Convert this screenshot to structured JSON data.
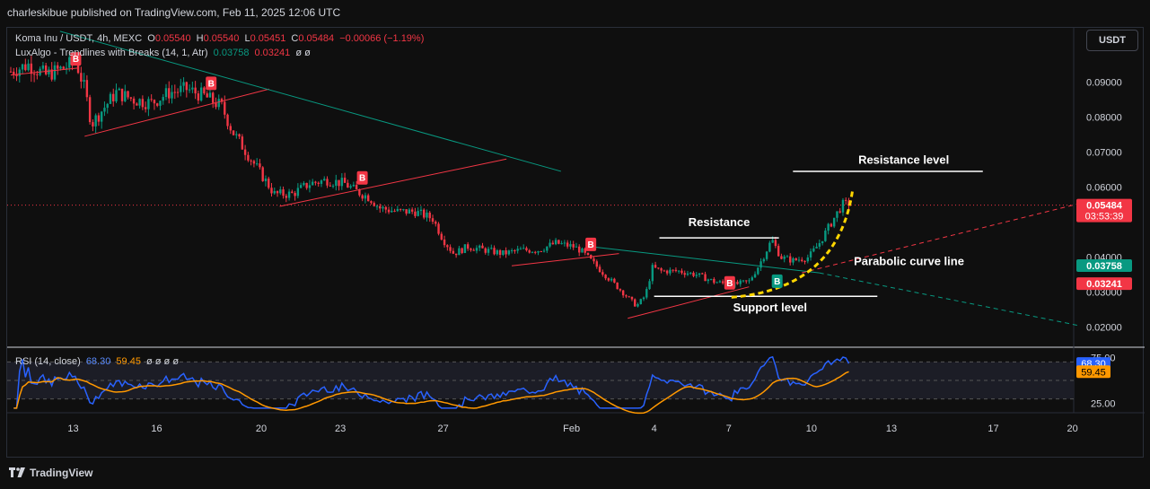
{
  "header": {
    "published": "charleskibue published on TradingView.com, Feb 11, 2025 12:06 UTC"
  },
  "legend": {
    "symbol": "Koma Inu / USDT, 4h, MEXC",
    "o_label": "O",
    "o_value": "0.05540",
    "h_label": "H",
    "h_value": "0.05540",
    "l_label": "L",
    "l_value": "0.05451",
    "c_label": "C",
    "c_value": "0.05484",
    "change": "−0.00066 (−1.19%)",
    "indicator": "LuxAlgo - Trendlines with Breaks (14, 1, Atr)",
    "ind_v1": "0.03758",
    "ind_v2": "0.03241",
    "ind_nulls": "ø ø",
    "rsi": "RSI (14, close)",
    "rsi_v1": "68.30",
    "rsi_v2": "59.45",
    "rsi_nulls": "ø ø ø ø"
  },
  "currency_button": "USDT",
  "branding": "TradingView",
  "colors": {
    "up": "#089981",
    "down": "#f23645",
    "rsi": "#2962ff",
    "rsi_ma": "#ff9800",
    "annotation_yellow": "#ffd600"
  },
  "chart_data": {
    "type": "candlestick",
    "symbol": "Koma Inu / USDT",
    "interval": "4h",
    "exchange": "MEXC",
    "x_tick_labels": [
      "13",
      "16",
      "20",
      "23",
      "27",
      "Feb",
      "4",
      "7",
      "10",
      "13",
      "17",
      "20"
    ],
    "y_ticks": [
      "0.09000",
      "0.08000",
      "0.07000",
      "0.06000",
      "0.04000",
      "0.03000",
      "0.02000"
    ],
    "ylim": [
      0.0145,
      0.1055
    ],
    "price_labels": [
      {
        "value": 0.05484,
        "text": "0.05484",
        "countdown": "03:53:39",
        "color": "#f23645"
      },
      {
        "value": 0.03758,
        "text": "0.03758",
        "color": "#089981"
      },
      {
        "value": 0.03241,
        "text": "0.03241",
        "color": "#f23645"
      }
    ],
    "ohlc_path": [
      [
        0,
        0.093
      ],
      [
        1,
        0.095
      ],
      [
        2,
        0.092
      ],
      [
        3,
        0.094
      ],
      [
        3.7,
        0.096
      ],
      [
        4.2,
        0.088
      ],
      [
        4.6,
        0.078
      ],
      [
        5.2,
        0.082
      ],
      [
        6,
        0.087
      ],
      [
        7,
        0.085
      ],
      [
        8,
        0.084
      ],
      [
        9,
        0.087
      ],
      [
        10,
        0.088
      ],
      [
        11,
        0.086
      ],
      [
        12,
        0.083
      ],
      [
        12.6,
        0.076
      ],
      [
        13.4,
        0.07
      ],
      [
        14.2,
        0.064
      ],
      [
        15,
        0.058
      ],
      [
        16,
        0.058
      ],
      [
        17,
        0.061
      ],
      [
        18,
        0.062
      ],
      [
        19,
        0.061
      ],
      [
        19.6,
        0.059
      ],
      [
        20.4,
        0.057
      ],
      [
        21,
        0.054
      ],
      [
        22,
        0.053
      ],
      [
        23,
        0.053
      ],
      [
        24,
        0.051
      ],
      [
        24.6,
        0.045
      ],
      [
        25.2,
        0.041
      ],
      [
        26,
        0.043
      ],
      [
        27,
        0.042
      ],
      [
        28,
        0.041
      ],
      [
        29,
        0.042
      ],
      [
        30,
        0.042
      ],
      [
        31,
        0.044
      ],
      [
        32,
        0.043
      ],
      [
        32.4,
        0.042
      ],
      [
        33.2,
        0.038
      ],
      [
        34,
        0.034
      ],
      [
        35,
        0.029
      ],
      [
        35.6,
        0.026
      ],
      [
        36.1,
        0.029
      ],
      [
        36.5,
        0.037
      ],
      [
        37,
        0.036
      ],
      [
        38,
        0.036
      ],
      [
        39,
        0.035
      ],
      [
        40,
        0.033
      ],
      [
        41,
        0.032
      ],
      [
        42,
        0.033
      ],
      [
        42.6,
        0.038
      ],
      [
        43.3,
        0.045
      ],
      [
        43.8,
        0.04
      ],
      [
        44.5,
        0.039
      ],
      [
        45.4,
        0.04
      ],
      [
        46,
        0.044
      ],
      [
        46.7,
        0.05
      ],
      [
        47.3,
        0.055
      ],
      [
        47.7,
        0.055
      ]
    ],
    "signals": [
      {
        "label": "B",
        "color": "#f23645",
        "x": 3.7,
        "price": 0.0965
      },
      {
        "label": "B",
        "color": "#f23645",
        "x": 11.4,
        "price": 0.0895
      },
      {
        "label": "B",
        "color": "#f23645",
        "x": 20,
        "price": 0.0625
      },
      {
        "label": "B",
        "color": "#f23645",
        "x": 33,
        "price": 0.0435
      },
      {
        "label": "B",
        "color": "#f23645",
        "x": 40.9,
        "price": 0.0325
      },
      {
        "label": "B",
        "color": "#089981",
        "x": 43.6,
        "price": 0.033
      }
    ],
    "annotations": [
      {
        "text": "Resistance level",
        "x": 50.8,
        "price": 0.0667
      },
      {
        "text": "Resistance",
        "x": 40.3,
        "price": 0.0488
      },
      {
        "text": "Parabolic curve line",
        "x": 51.1,
        "price": 0.0377
      },
      {
        "text": "Support level",
        "x": 43.2,
        "price": 0.0245
      }
    ],
    "rsi": {
      "title": "RSI (14, close)",
      "period": 14,
      "current": 68.3,
      "ma_current": 59.45,
      "y_ticks": [
        "75.00",
        "25.00"
      ],
      "levels": [
        70,
        50,
        30
      ],
      "ylim": [
        15,
        85
      ]
    }
  }
}
